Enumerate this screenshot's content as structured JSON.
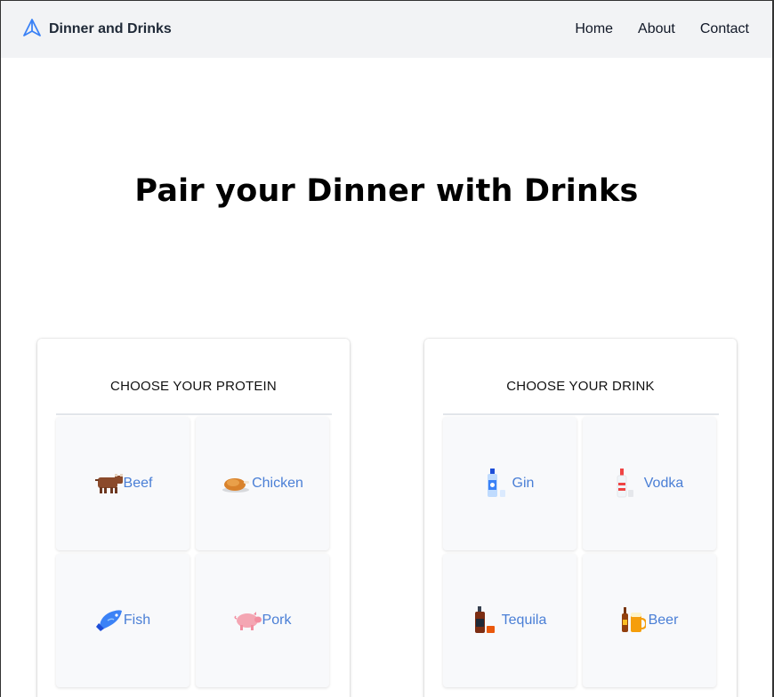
{
  "nav": {
    "brand": "Dinner and Drinks",
    "links": [
      "Home",
      "About",
      "Contact"
    ]
  },
  "hero": {
    "title": "Pair your Dinner with Drinks"
  },
  "protein": {
    "title": "CHOOSE YOUR PROTEIN",
    "items": [
      {
        "label": "Beef",
        "icon": "cow-icon"
      },
      {
        "label": "Chicken",
        "icon": "roast-chicken-icon"
      },
      {
        "label": "Fish",
        "icon": "fish-icon"
      },
      {
        "label": "Pork",
        "icon": "pig-icon"
      }
    ]
  },
  "drink": {
    "title": "CHOOSE YOUR DRINK",
    "items": [
      {
        "label": "Gin",
        "icon": "gin-bottle-icon"
      },
      {
        "label": "Vodka",
        "icon": "vodka-bottle-icon"
      },
      {
        "label": "Tequila",
        "icon": "tequila-bottle-icon"
      },
      {
        "label": "Beer",
        "icon": "beer-icon"
      }
    ]
  },
  "colors": {
    "navbar_bg": "#f2f3f5",
    "link_blue": "#4a7fd6",
    "tile_bg": "#f8f9fb"
  }
}
